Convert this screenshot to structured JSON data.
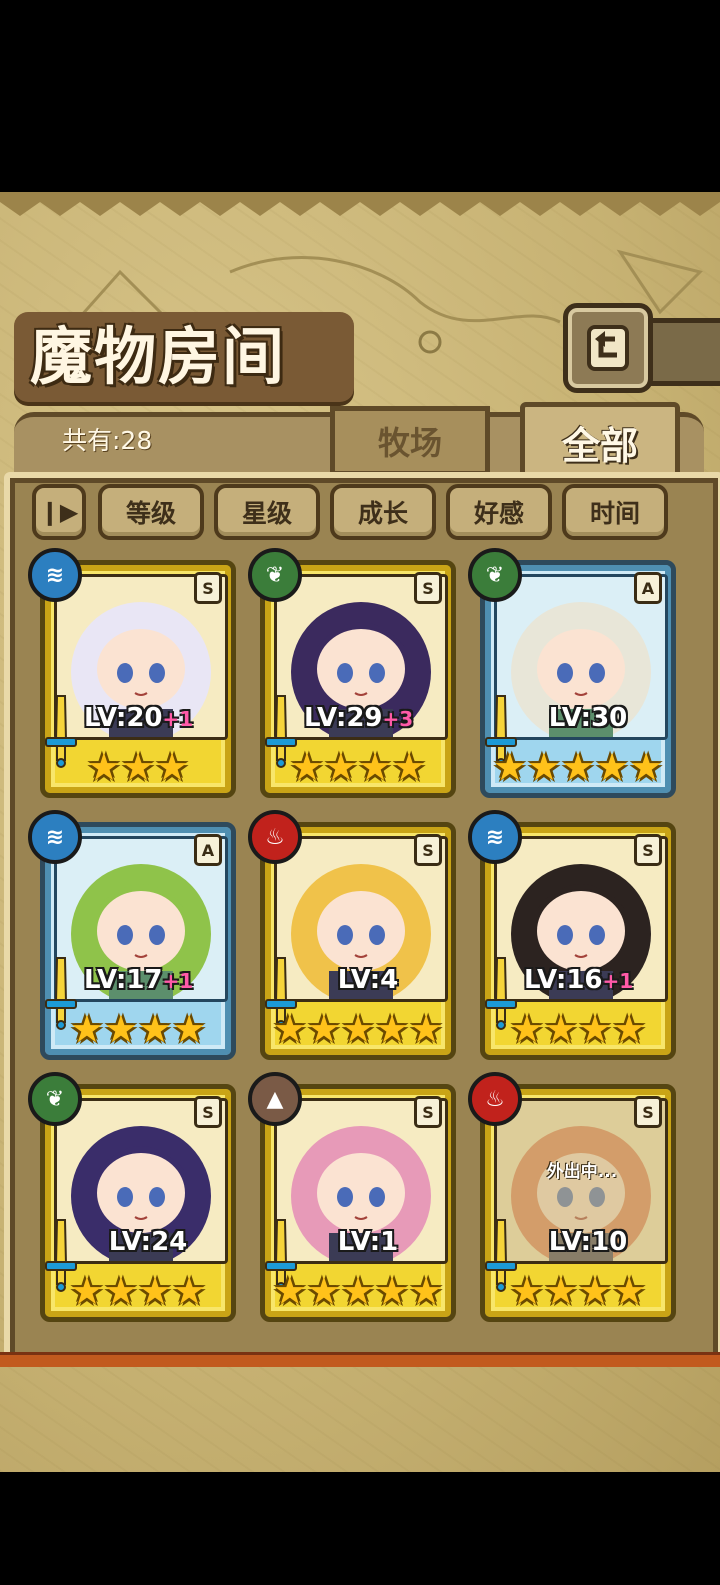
{
  "header": {
    "title": "魔物房间",
    "back_icon": "return-arrow-icon"
  },
  "stats": {
    "count_label": "共有:28"
  },
  "tabs": [
    {
      "label": "牧场",
      "active": false
    },
    {
      "label": "全部",
      "active": true
    }
  ],
  "sort_buttons": [
    {
      "label": "等级"
    },
    {
      "label": "星级"
    },
    {
      "label": "成长"
    },
    {
      "label": "好感"
    },
    {
      "label": "时间"
    }
  ],
  "sort_toggle_icon": "pause-sort-toggle-icon",
  "monsters": [
    {
      "element": "water",
      "rank": "S",
      "level": "LV:20",
      "bonus": "+1",
      "stars": 3,
      "frame": "gold",
      "away": ""
    },
    {
      "element": "wood",
      "rank": "S",
      "level": "LV:29",
      "bonus": "+3",
      "stars": 4,
      "frame": "gold",
      "away": ""
    },
    {
      "element": "wood",
      "rank": "A",
      "level": "LV:30",
      "bonus": "",
      "stars": 5,
      "frame": "blue",
      "away": ""
    },
    {
      "element": "water",
      "rank": "A",
      "level": "LV:17",
      "bonus": "+1",
      "stars": 4,
      "frame": "blue",
      "away": ""
    },
    {
      "element": "fire",
      "rank": "S",
      "level": "LV:4",
      "bonus": "",
      "stars": 5,
      "frame": "gold",
      "away": ""
    },
    {
      "element": "water",
      "rank": "S",
      "level": "LV:16",
      "bonus": "+1",
      "stars": 4,
      "frame": "gold",
      "away": ""
    },
    {
      "element": "wood",
      "rank": "S",
      "level": "LV:24",
      "bonus": "",
      "stars": 4,
      "frame": "gold",
      "away": ""
    },
    {
      "element": "earth",
      "rank": "S",
      "level": "LV:1",
      "bonus": "",
      "stars": 5,
      "frame": "gold",
      "away": ""
    },
    {
      "element": "fire",
      "rank": "S",
      "level": "LV:10",
      "bonus": "",
      "stars": 4,
      "frame": "gold",
      "away": "外出中..."
    }
  ],
  "colors": {
    "parchment": "#c7b273",
    "panel": "#9a8452",
    "gold_frame": "#f2d632",
    "blue_frame": "#9fd6ee",
    "star": "#ffc21a",
    "bonus": "#ff5aa8"
  }
}
